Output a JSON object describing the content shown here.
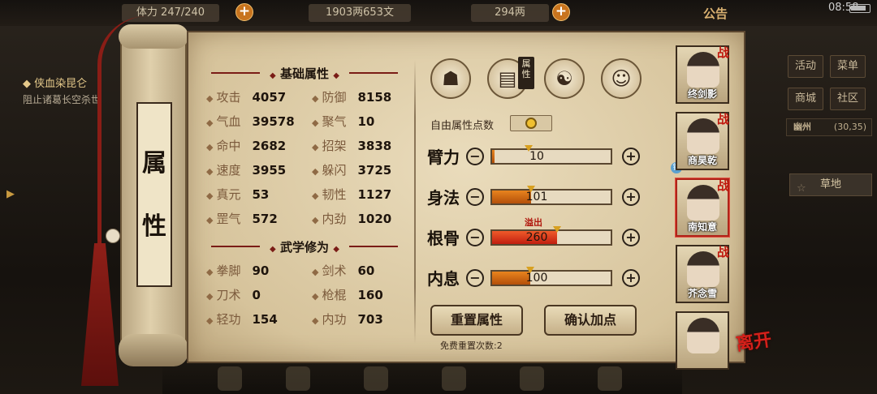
{
  "top_bar": {
    "stamina": "体力 247/240",
    "money": "1903两653文",
    "ingot": "294两",
    "notice": "公告",
    "time": "08:58"
  },
  "quest": {
    "title": "侠血染昆仑",
    "desc": "阻止诸葛长空杀世"
  },
  "right_menu": {
    "items": [
      "活动",
      "菜单",
      "商城",
      "社区"
    ],
    "location": "幽州",
    "coords": "(30,35)",
    "terrain": "草地"
  },
  "scroll_title": [
    "属",
    "性"
  ],
  "base_section": "基础属性",
  "martial_section": "武学修为",
  "base_stats": [
    {
      "label": "攻击",
      "value": "4057"
    },
    {
      "label": "防御",
      "value": "8158"
    },
    {
      "label": "气血",
      "value": "39578"
    },
    {
      "label": "聚气",
      "value": "10"
    },
    {
      "label": "命中",
      "value": "2682"
    },
    {
      "label": "招架",
      "value": "3838"
    },
    {
      "label": "速度",
      "value": "3955"
    },
    {
      "label": "躲闪",
      "value": "3725"
    },
    {
      "label": "真元",
      "value": "53"
    },
    {
      "label": "韧性",
      "value": "1127"
    },
    {
      "label": "罡气",
      "value": "572"
    },
    {
      "label": "内劲",
      "value": "1020"
    }
  ],
  "martial_stats": [
    {
      "label": "拳脚",
      "value": "90"
    },
    {
      "label": "剑术",
      "value": "60"
    },
    {
      "label": "刀术",
      "value": "0"
    },
    {
      "label": "枪棍",
      "value": "160"
    },
    {
      "label": "轻功",
      "value": "154"
    },
    {
      "label": "内功",
      "value": "703"
    }
  ],
  "tabs": {
    "badge": "属性"
  },
  "free_points_label": "自由属性点数",
  "free_points": "0",
  "attributes": [
    {
      "name": "臂力",
      "value": "10",
      "fill": 0.02,
      "overflow": false
    },
    {
      "name": "身法",
      "value": "101",
      "fill": 0.33,
      "overflow": false
    },
    {
      "name": "根骨",
      "value": "260",
      "fill": 0.55,
      "overflow": true
    },
    {
      "name": "内息",
      "value": "100",
      "fill": 0.32,
      "overflow": false
    }
  ],
  "overflow_label": "溢出",
  "buttons": {
    "reset": "重置属性",
    "confirm": "确认加点",
    "free_reset": "免费重置次数:2",
    "leave": "离开"
  },
  "characters": [
    {
      "name": "终剑影",
      "tag": "战"
    },
    {
      "name": "商昊乾",
      "tag": "战"
    },
    {
      "name": "南知意",
      "tag": "战"
    },
    {
      "name": "芥念雪",
      "tag": "战"
    },
    {
      "name": "",
      "tag": ""
    }
  ],
  "colors": {
    "accent_red": "#b0241a",
    "bar_orange": "#e8841e",
    "bar_red": "#ef5a2a",
    "paper": "#eadcbc"
  }
}
